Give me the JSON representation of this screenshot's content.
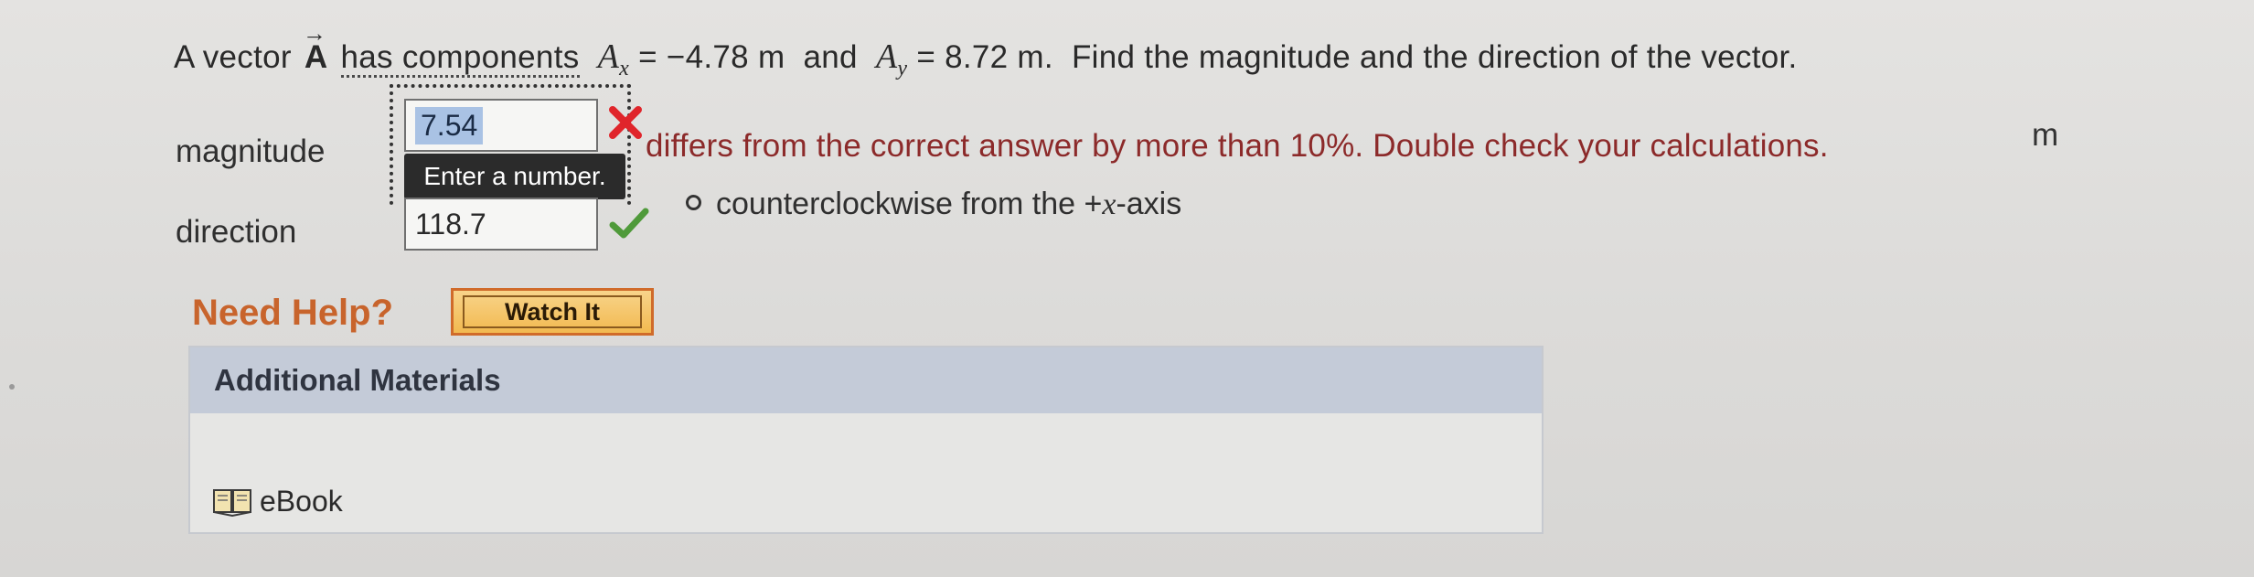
{
  "question": {
    "prefix": "A vector",
    "vector_name": "A",
    "arrow": "→",
    "has_components": "has components",
    "ax_symbol": "A",
    "ax_sub": "x",
    "ax_value": "= −4.78 m",
    "and": "and",
    "ay_symbol": "A",
    "ay_sub": "y",
    "ay_value": "= 8.72 m.",
    "suffix": "Find the magnitude and the direction of the vector."
  },
  "magnitude": {
    "label": "magnitude",
    "value": "7.54",
    "tooltip": "Enter a number.",
    "feedback": "differs from the correct answer by more than 10%. Double check your calculations.",
    "unit": "m",
    "status": "incorrect"
  },
  "direction": {
    "label": "direction",
    "value": "118.7",
    "unit_text": "counterclockwise from the",
    "axis_sign": "+",
    "axis_var": "x",
    "axis_suffix": "-axis",
    "status": "correct"
  },
  "help": {
    "title": "Need Help?",
    "watch_label": "Watch It"
  },
  "materials": {
    "header": "Additional Materials",
    "ebook_label": "eBook"
  },
  "colors": {
    "incorrect": "#e0252b",
    "correct": "#4f9a3a",
    "feedback_text": "#8c2a2a",
    "need_help": "#c8642c",
    "watch_button": "#f2b950",
    "materials_header": "#c4cbd8"
  },
  "icons": [
    "x-icon",
    "check-icon",
    "book-icon",
    "degree-icon"
  ]
}
